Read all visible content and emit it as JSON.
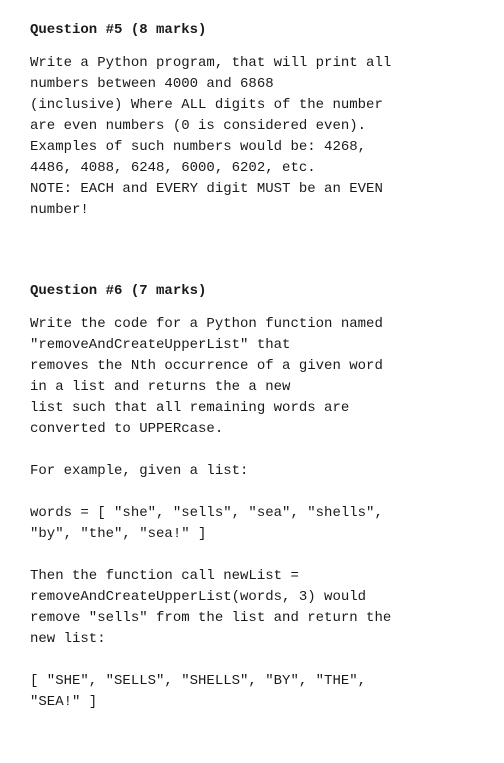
{
  "questions": [
    {
      "id": "q5",
      "title": "Question #5 (8 marks)",
      "body": "Write a Python program, that will print all\nnumbers between 4000 and 6868\n(inclusive) Where ALL digits of the number\nare even numbers (0 is considered even).\nExamples of such numbers would be: 4268,\n4486, 4088, 6248, 6000, 6202, etc.\nNOTE: EACH and EVERY digit MUST be an EVEN\nnumber!"
    },
    {
      "id": "q6",
      "title": "Question #6 (7 marks)",
      "body": "Write the code for a Python function named\n\"removeAndCreateUpperList\" that\nremoves the Nth occurrence of a given word\nin a list and returns the a new\nlist such that all remaining words are\nconverted to UPPERcase.\n\nFor example, given a list:\n\nwords = [ \"she\", \"sells\", \"sea\", \"shells\",\n\"by\", \"the\", \"sea!\" ]\n\nThen the function call newList =\nremoveAndCreateUpperList(words, 3) would\nremove \"sells\" from the list and return the\nnew list:\n\n[ \"SHE\", \"SELLS\", \"SHELLS\", \"BY\", \"THE\",\n\"SEA!\" ]"
    }
  ]
}
